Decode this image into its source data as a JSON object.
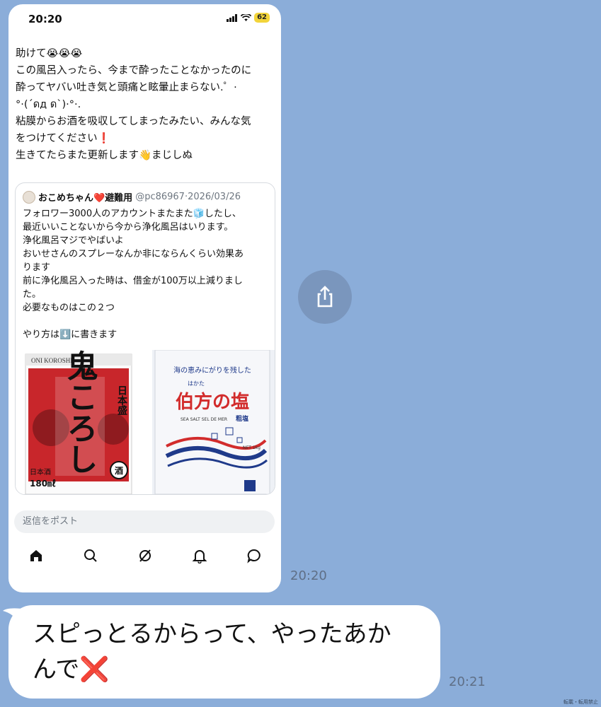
{
  "status_bar": {
    "time": "20:20",
    "battery": "62"
  },
  "post": {
    "lines": [
      "助けて😭😭😭",
      "この風呂入ったら、今まで酔ったことなかったのに",
      "酔ってヤバい吐き気と頭痛と眩暈止まらない.゜·",
      "°·(´ดд ด`)·°·.",
      "粘膜からお酒を吸収してしまったみたい、みんな気",
      "をつけてください❗",
      "生きてたらまた更新します👋まじしぬ"
    ]
  },
  "quote": {
    "name": "おこめちゃん❤️避難用",
    "handle": "@pc86967·2026/03/26",
    "lines": [
      "フォロワー3000人のアカウントまたまた🧊したし、",
      "最近いいことないから今から浄化風呂はいります。",
      "浄化風呂マジでやばいよ",
      "おいせさんのスプレーなんか非にならんくらい効果あ",
      "ります",
      "前に浄化風呂入った時は、借金が100万以上減りまし",
      "た。",
      "必要なものはこの２つ",
      "",
      "やり方は⬇️に書きます"
    ],
    "image1": {
      "top": "ONI KOROSHI",
      "brand": "日本盛",
      "main": "鬼ころし",
      "kind": "日本酒",
      "volume": "180㎖",
      "badge": "酒"
    },
    "image2": {
      "tagline": "海の恵みにがりを残した",
      "name_ruby": "はかた",
      "name": "伯方の塩",
      "en": "SEA SALT SEL DE MER",
      "grade": "粗塩",
      "weight": "NET 1kg"
    }
  },
  "reply_placeholder": "返信をポスト",
  "tabs": [
    "home",
    "search",
    "grok",
    "notifications",
    "messages"
  ],
  "times": {
    "first": "20:20",
    "second": "20:21"
  },
  "message": {
    "lines": [
      "スピっとるからって、やったあか",
      "んで❌"
    ]
  },
  "watermark": "転載・転用禁止",
  "colors": {
    "background": "#8badd9",
    "bubble": "#ffffff",
    "accent_red": "#d22c2c"
  }
}
